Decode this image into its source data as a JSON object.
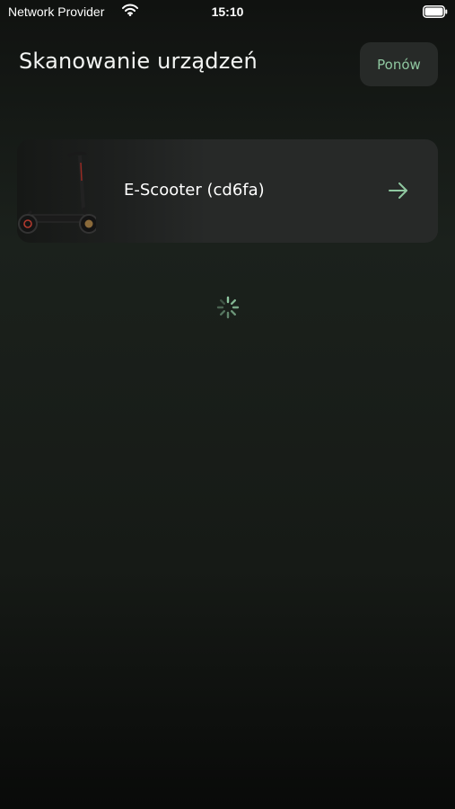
{
  "status_bar": {
    "carrier": "Network Provider",
    "time": "15:10",
    "wifi_icon": "wifi-icon",
    "battery_icon": "battery-icon"
  },
  "header": {
    "title": "Skanowanie urządzeń",
    "retry_label": "Ponów"
  },
  "devices": [
    {
      "name": "E-Scooter (cd6fa)",
      "image": "scooter-image",
      "action_icon": "arrow-right-icon"
    }
  ],
  "loading": {
    "icon": "loading-spinner-icon"
  },
  "colors": {
    "accent": "#8fc7a0",
    "card_background": "#272928",
    "button_background": "#272a28",
    "background": "#161a16"
  }
}
